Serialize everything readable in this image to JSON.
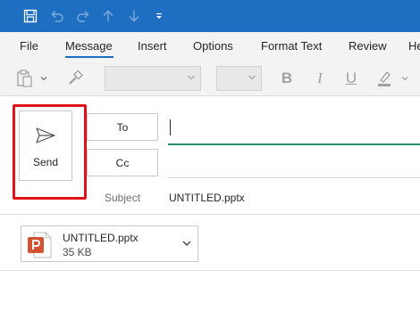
{
  "quick_access": {
    "icons": [
      "save-icon",
      "undo-icon",
      "redo-icon",
      "arrow-up-icon",
      "arrow-down-icon",
      "customize-qat-icon"
    ]
  },
  "ribbon_tabs": [
    {
      "label": "File"
    },
    {
      "label": "Message",
      "active": true
    },
    {
      "label": "Insert"
    },
    {
      "label": "Options"
    },
    {
      "label": "Format Text"
    },
    {
      "label": "Review"
    },
    {
      "label": "He"
    }
  ],
  "ribbon": {
    "font_name_value": "",
    "font_size_value": "",
    "bold": "B",
    "italic": "I",
    "underline": "U"
  },
  "compose": {
    "send_label": "Send",
    "to_label": "To",
    "cc_label": "Cc",
    "to_value": "",
    "cc_value": "",
    "subject_label": "Subject",
    "subject_value": "UNTITLED.pptx"
  },
  "attachment": {
    "name": "UNTITLED.pptx",
    "size": "35 KB",
    "icon": "powerpoint-file-icon"
  },
  "colors": {
    "title_bar": "#1e6fc1",
    "highlight_border": "#e0101b",
    "to_underline": "#2a8a72",
    "powerpoint": "#d35230"
  }
}
